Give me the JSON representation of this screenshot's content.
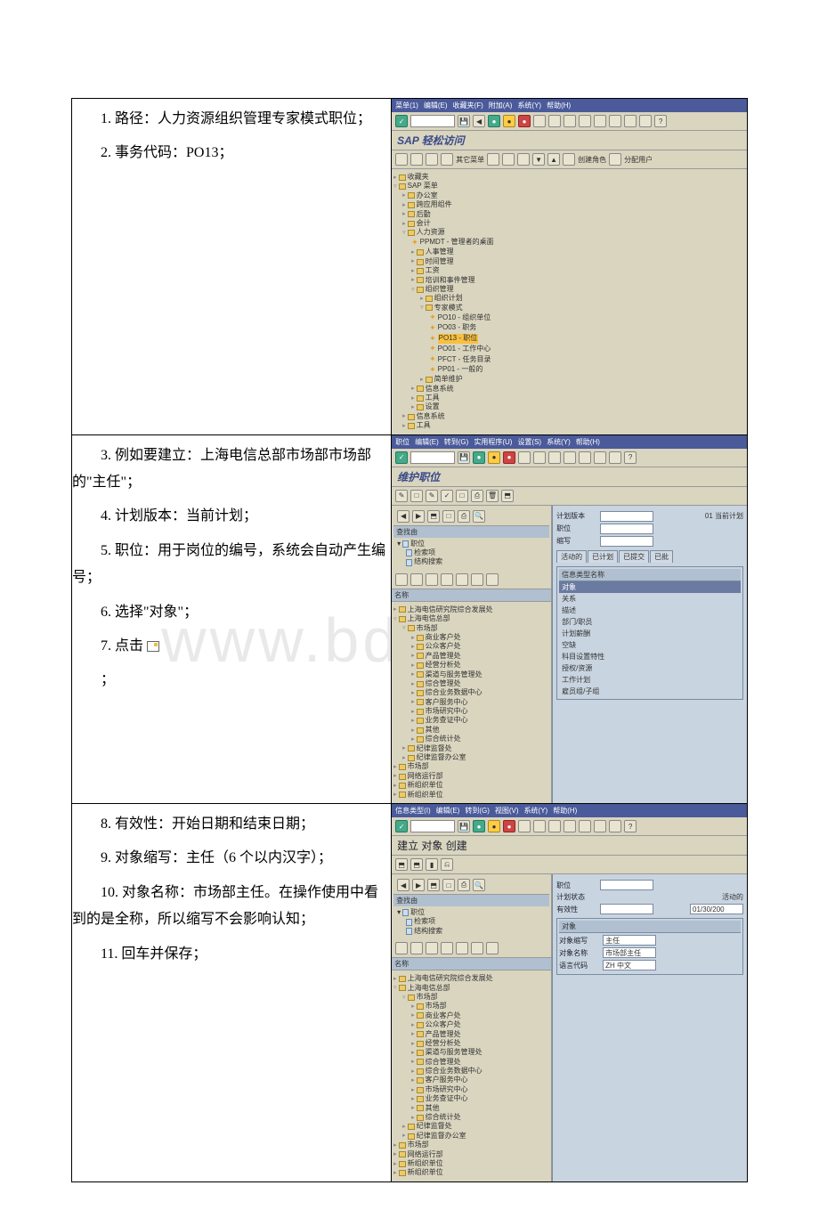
{
  "watermark": "www.bdocx.com",
  "rows": [
    {
      "text": [
        "1. 路径：人力资源组织管理专家模式职位；",
        "2. 事务代码：PO13；"
      ],
      "sap": {
        "menubar": [
          "菜单(1)",
          "编辑(E)",
          "收藏夹(F)",
          "附加(A)",
          "系统(Y)",
          "帮助(H)"
        ],
        "title": "SAP 轻松访问",
        "subtoolbar_labels": [
          "其它菜单",
          "创建角色",
          "分配用户"
        ],
        "tree": [
          {
            "lvl": 0,
            "icon": "fld",
            "txt": "收藏夹"
          },
          {
            "lvl": 0,
            "icon": "fld",
            "txt": "SAP 菜单",
            "open": true
          },
          {
            "lvl": 1,
            "icon": "fld",
            "txt": "办公室"
          },
          {
            "lvl": 1,
            "icon": "fld",
            "txt": "跨应用组件"
          },
          {
            "lvl": 1,
            "icon": "fld",
            "txt": "后勤"
          },
          {
            "lvl": 1,
            "icon": "fld",
            "txt": "会计"
          },
          {
            "lvl": 1,
            "icon": "fld",
            "txt": "人力资源",
            "open": true
          },
          {
            "lvl": 2,
            "icon": "star",
            "txt": "PPMDT - 管理者的桌面"
          },
          {
            "lvl": 2,
            "icon": "fld",
            "txt": "人事管理"
          },
          {
            "lvl": 2,
            "icon": "fld",
            "txt": "时间管理"
          },
          {
            "lvl": 2,
            "icon": "fld",
            "txt": "工资"
          },
          {
            "lvl": 2,
            "icon": "fld",
            "txt": "培训和事件管理"
          },
          {
            "lvl": 2,
            "icon": "fld",
            "txt": "组织管理",
            "open": true
          },
          {
            "lvl": 3,
            "icon": "fld",
            "txt": "组织计划"
          },
          {
            "lvl": 3,
            "icon": "fld",
            "txt": "专家模式",
            "open": true
          },
          {
            "lvl": 4,
            "icon": "star",
            "txt": "PO10 - 组织单位"
          },
          {
            "lvl": 4,
            "icon": "star",
            "txt": "PO03 - 职务"
          },
          {
            "lvl": 4,
            "icon": "star",
            "txt": "PO13 - 职位",
            "hl": true
          },
          {
            "lvl": 4,
            "icon": "star",
            "txt": "PO01 - 工作中心"
          },
          {
            "lvl": 4,
            "icon": "star",
            "txt": "PFCT - 任务目录"
          },
          {
            "lvl": 4,
            "icon": "star",
            "txt": "PP01 - 一般的"
          },
          {
            "lvl": 3,
            "icon": "fld",
            "txt": "简单维护"
          },
          {
            "lvl": 2,
            "icon": "fld",
            "txt": "信息系统"
          },
          {
            "lvl": 2,
            "icon": "fld",
            "txt": "工具"
          },
          {
            "lvl": 2,
            "icon": "fld",
            "txt": "设置"
          },
          {
            "lvl": 1,
            "icon": "fld",
            "txt": "信息系统"
          },
          {
            "lvl": 1,
            "icon": "fld",
            "txt": "工具"
          }
        ]
      }
    },
    {
      "text": [
        "3. 例如要建立：上海电信总部市场部市场部的\"主任\"；",
        "4. 计划版本：当前计划；",
        "5. 职位：用于岗位的编号，系统会自动产生编号；",
        "6. 选择\"对象\"；",
        "7. 点击"
      ],
      "text_tail": "；",
      "sap": {
        "menubar": [
          "职位",
          "编辑(E)",
          "转到(G)",
          "实用程序(U)",
          "设置(S)",
          "系统(Y)",
          "帮助(H)"
        ],
        "title": "维护职位",
        "find_title": "查找由",
        "find_items": [
          "职位",
          "检索项",
          "结构搜索"
        ],
        "form": [
          {
            "lbl": "计划版本",
            "val": "",
            "extra": "01 当前计划"
          },
          {
            "lbl": "职位",
            "val": ""
          },
          {
            "lbl": "缩写",
            "val": ""
          }
        ],
        "tabstrip": [
          "活动的",
          "已计划",
          "已提交",
          "已批"
        ],
        "listbox_hdr": "信息类型名称",
        "listbox": [
          {
            "txt": "对象",
            "sel": true
          },
          {
            "txt": "关系"
          },
          {
            "txt": "描述"
          },
          {
            "txt": "部门/职员"
          },
          {
            "txt": "计划薪酬"
          },
          {
            "txt": "空缺"
          },
          {
            "txt": "科目设置特性"
          },
          {
            "txt": "授权/资源"
          },
          {
            "txt": "工作计划"
          },
          {
            "txt": "雇员组/子组"
          }
        ],
        "tree_hdr": "名称",
        "tree": [
          {
            "lvl": 0,
            "icon": "fld",
            "txt": "上海电信研究院综合发展处"
          },
          {
            "lvl": 0,
            "icon": "fld",
            "txt": "上海电信总部",
            "open": true
          },
          {
            "lvl": 1,
            "icon": "fld",
            "txt": "市场部",
            "open": true
          },
          {
            "lvl": 2,
            "icon": "fld",
            "txt": "商业客户处"
          },
          {
            "lvl": 2,
            "icon": "fld",
            "txt": "公众客户处"
          },
          {
            "lvl": 2,
            "icon": "fld",
            "txt": "产品管理处"
          },
          {
            "lvl": 2,
            "icon": "fld",
            "txt": "经营分析处"
          },
          {
            "lvl": 2,
            "icon": "fld",
            "txt": "渠道与服务管理处"
          },
          {
            "lvl": 2,
            "icon": "fld",
            "txt": "综合管理处"
          },
          {
            "lvl": 2,
            "icon": "fld",
            "txt": "综合业务数据中心"
          },
          {
            "lvl": 2,
            "icon": "fld",
            "txt": "客户服务中心"
          },
          {
            "lvl": 2,
            "icon": "fld",
            "txt": "市场研究中心"
          },
          {
            "lvl": 2,
            "icon": "fld",
            "txt": "业务查证中心"
          },
          {
            "lvl": 2,
            "icon": "fld",
            "txt": "其他"
          },
          {
            "lvl": 2,
            "icon": "fld",
            "txt": "综合统计处"
          },
          {
            "lvl": 1,
            "icon": "fld",
            "txt": "纪律监督处"
          },
          {
            "lvl": 1,
            "icon": "fld",
            "txt": "纪律监督办公室"
          },
          {
            "lvl": 0,
            "icon": "fld",
            "txt": "市场部"
          },
          {
            "lvl": 0,
            "icon": "fld",
            "txt": "网络运行部"
          },
          {
            "lvl": 0,
            "icon": "fld",
            "txt": "新组织单位"
          },
          {
            "lvl": 0,
            "icon": "fld",
            "txt": "新组织单位"
          }
        ]
      }
    },
    {
      "text": [
        "8. 有效性：开始日期和结束日期；",
        "9. 对象缩写：主任（6 个以内汉字）；",
        "10. 对象名称：市场部主任。在操作使用中看到的是全称，所以缩写不会影响认知；",
        "11. 回车并保存；"
      ],
      "sap": {
        "menubar": [
          "信息类型(I)",
          "编辑(E)",
          "转到(G)",
          "视图(V)",
          "系统(Y)",
          "帮助(H)"
        ],
        "title": "建立 对象 创建",
        "find_title": "查找由",
        "find_items": [
          "职位",
          "检索项",
          "结构搜索"
        ],
        "form_top": [
          {
            "lbl": "职位",
            "val": ""
          },
          {
            "lbl": "计划状态",
            "val": "活动的"
          },
          {
            "lbl": "有效性",
            "val": "",
            "extra": "01/30/200"
          }
        ],
        "form_obj_hdr": "对象",
        "form_obj": [
          {
            "lbl": "对象缩写",
            "val": "主任"
          },
          {
            "lbl": "对象名称",
            "val": "市场部主任"
          },
          {
            "lbl": "语言代码",
            "val": "ZH 中文"
          }
        ],
        "tree_hdr": "名称",
        "tree": [
          {
            "lvl": 0,
            "icon": "fld",
            "txt": "上海电信研究院综合发展处"
          },
          {
            "lvl": 0,
            "icon": "fld",
            "txt": "上海电信总部",
            "open": true
          },
          {
            "lvl": 1,
            "icon": "fld",
            "txt": "市场部",
            "open": true
          },
          {
            "lvl": 2,
            "icon": "fld",
            "txt": "市场部"
          },
          {
            "lvl": 2,
            "icon": "fld",
            "txt": "商业客户处"
          },
          {
            "lvl": 2,
            "icon": "fld",
            "txt": "公众客户处"
          },
          {
            "lvl": 2,
            "icon": "fld",
            "txt": "产品管理处"
          },
          {
            "lvl": 2,
            "icon": "fld",
            "txt": "经营分析处"
          },
          {
            "lvl": 2,
            "icon": "fld",
            "txt": "渠道与服务管理处"
          },
          {
            "lvl": 2,
            "icon": "fld",
            "txt": "综合管理处"
          },
          {
            "lvl": 2,
            "icon": "fld",
            "txt": "综合业务数据中心"
          },
          {
            "lvl": 2,
            "icon": "fld",
            "txt": "客户服务中心"
          },
          {
            "lvl": 2,
            "icon": "fld",
            "txt": "市场研究中心"
          },
          {
            "lvl": 2,
            "icon": "fld",
            "txt": "业务查证中心"
          },
          {
            "lvl": 2,
            "icon": "fld",
            "txt": "其他"
          },
          {
            "lvl": 2,
            "icon": "fld",
            "txt": "综合统计处"
          },
          {
            "lvl": 1,
            "icon": "fld",
            "txt": "纪律监督处"
          },
          {
            "lvl": 1,
            "icon": "fld",
            "txt": "纪律监督办公室"
          },
          {
            "lvl": 0,
            "icon": "fld",
            "txt": "市场部"
          },
          {
            "lvl": 0,
            "icon": "fld",
            "txt": "网络运行部"
          },
          {
            "lvl": 0,
            "icon": "fld",
            "txt": "新组织单位"
          },
          {
            "lvl": 0,
            "icon": "fld",
            "txt": "新组织单位"
          }
        ]
      }
    }
  ]
}
